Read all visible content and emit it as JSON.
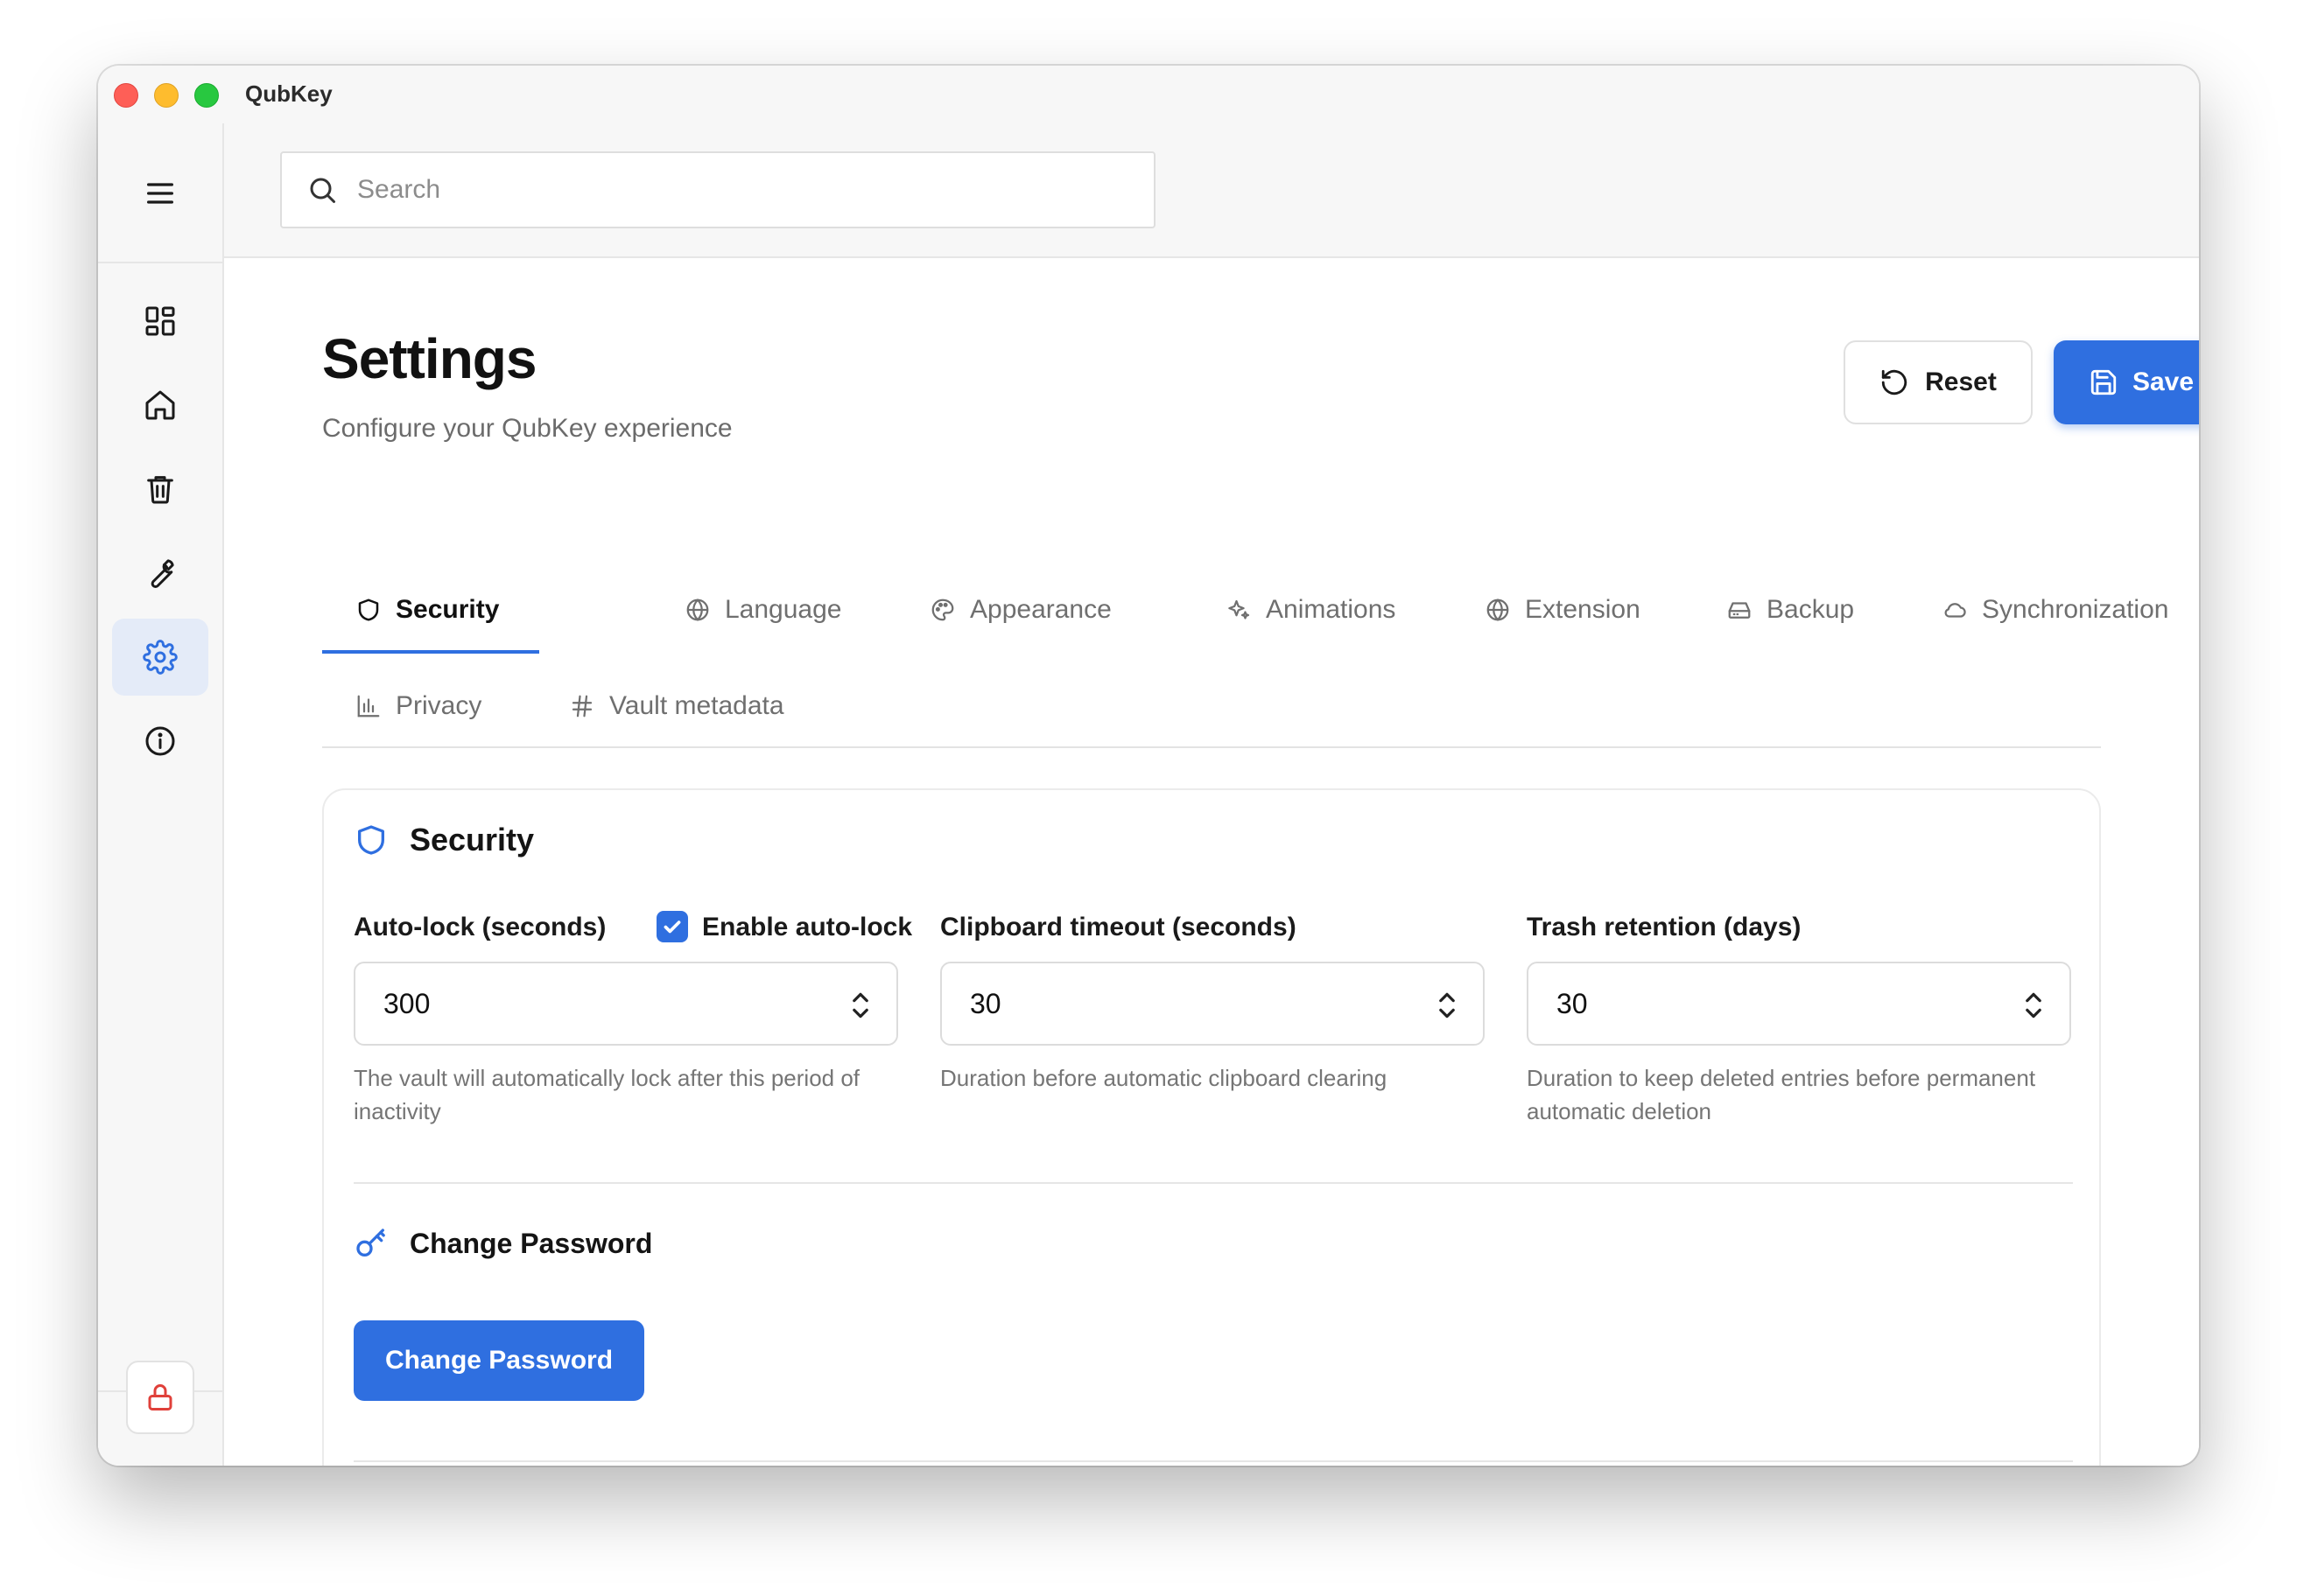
{
  "app": {
    "title": "QubKey"
  },
  "colors": {
    "accent": "#2f6fe0",
    "danger": "#e0403a"
  },
  "sidebar": {
    "menu_icon": "hamburger-icon",
    "items": [
      {
        "icon": "grid-icon",
        "name": "dashboard",
        "active": false
      },
      {
        "icon": "home-icon",
        "name": "home",
        "active": false
      },
      {
        "icon": "trash-icon",
        "name": "trash",
        "active": false
      },
      {
        "icon": "wrench-icon",
        "name": "tools",
        "active": false
      },
      {
        "icon": "gear-icon",
        "name": "settings",
        "active": true
      },
      {
        "icon": "info-icon",
        "name": "about",
        "active": false
      }
    ],
    "lock_icon": "lock-icon"
  },
  "search": {
    "placeholder": "Search",
    "value": ""
  },
  "page": {
    "title": "Settings",
    "subtitle": "Configure your QubKey experience",
    "reset_label": "Reset",
    "save_label": "Save"
  },
  "tabs": [
    {
      "label": "Security",
      "icon": "shield-icon",
      "active": true
    },
    {
      "label": "Language",
      "icon": "globe-icon",
      "active": false
    },
    {
      "label": "Appearance",
      "icon": "palette-icon",
      "active": false
    },
    {
      "label": "Animations",
      "icon": "sparkles-icon",
      "active": false
    },
    {
      "label": "Extension",
      "icon": "globe-icon",
      "active": false
    },
    {
      "label": "Backup",
      "icon": "drive-icon",
      "active": false
    },
    {
      "label": "Synchronization",
      "icon": "cloud-icon",
      "active": false
    },
    {
      "label": "Privacy",
      "icon": "bar-chart-icon",
      "active": false
    },
    {
      "label": "Vault metadata",
      "icon": "hash-icon",
      "active": false
    }
  ],
  "security": {
    "title": "Security",
    "autolock": {
      "label": "Auto-lock (seconds)",
      "checkbox_label": "Enable auto-lock",
      "enabled": true,
      "value": "300",
      "help": "The vault will automatically lock after this period of inactivity"
    },
    "clipboard": {
      "label": "Clipboard timeout (seconds)",
      "value": "30",
      "help": "Duration before automatic clipboard clearing"
    },
    "trash": {
      "label": "Trash retention (days)",
      "value": "30",
      "help": "Duration to keep deleted entries before permanent automatic deletion"
    }
  },
  "password": {
    "title": "Change Password",
    "button_label": "Change Password"
  }
}
